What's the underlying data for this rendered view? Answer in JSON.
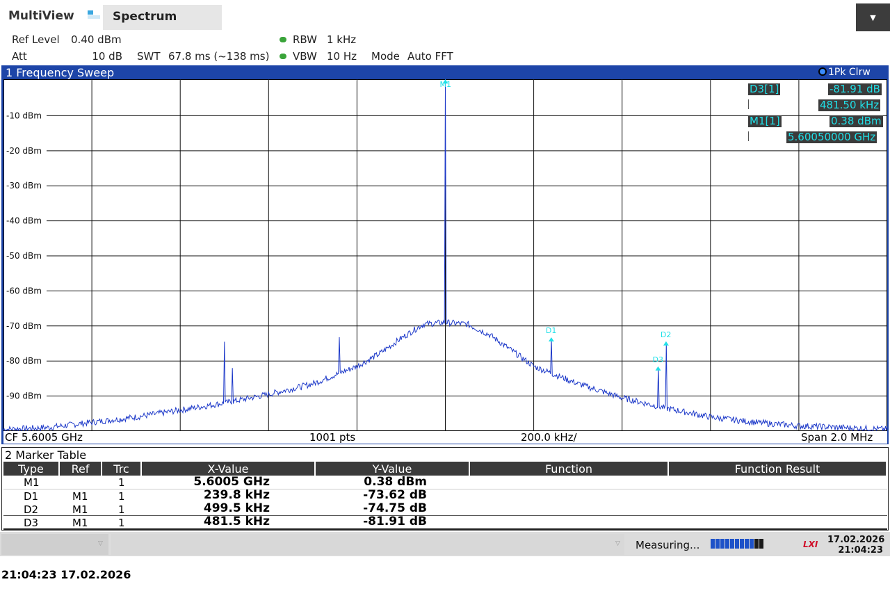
{
  "app": {
    "multiview_label": "MultiView",
    "tab_label": "Spectrum",
    "menu_glyph": "▼"
  },
  "settings": {
    "ref_level_label": "Ref Level",
    "ref_level_value": "0.40 dBm",
    "att_label": "Att",
    "att_value": "10 dB",
    "swt_label": "SWT",
    "swt_value": "67.8 ms (~138 ms)",
    "rbw_label": "RBW",
    "rbw_value": "1 kHz",
    "vbw_label": "VBW",
    "vbw_value": "10 Hz",
    "mode_label": "Mode",
    "mode_value": "Auto FFT"
  },
  "diagram1": {
    "title": "1 Frequency Sweep",
    "trace_label": "1Pk Clrw",
    "footer": {
      "cf": "CF 5.6005 GHz",
      "points": "1001 pts",
      "div": "200.0 kHz/",
      "span": "Span 2.0 MHz"
    }
  },
  "marker_info": {
    "d3_label": "D3[1]",
    "d3_value": "-81.91 dB",
    "d3_freq": "481.50 kHz",
    "m1_label": "M1[1]",
    "m1_value": "0.38 dBm",
    "m1_freq": "5.60050000 GHz"
  },
  "chart_data": {
    "type": "line",
    "xlabel": "",
    "ylabel": "",
    "center_freq_ghz": 5.6005,
    "span_mhz": 2.0,
    "ylim": [
      -100,
      0.4
    ],
    "y_ticks": [
      "-10 dBm",
      "-20 dBm",
      "-30 dBm",
      "-40 dBm",
      "-50 dBm",
      "-60 dBm",
      "-70 dBm",
      "-80 dBm",
      "-90 dBm"
    ],
    "y_tick_values": [
      -10,
      -20,
      -30,
      -40,
      -50,
      -60,
      -70,
      -80,
      -90
    ],
    "grid": true,
    "series": [
      {
        "color": "#1d39c9",
        "points_offset_khz_dbm": [
          [
            -1000,
            -99.5
          ],
          [
            -900,
            -99
          ],
          [
            -800,
            -97.5
          ],
          [
            -700,
            -96
          ],
          [
            -600,
            -94
          ],
          [
            -500,
            -92
          ],
          [
            -400,
            -89.5
          ],
          [
            -300,
            -86.5
          ],
          [
            -200,
            -81.5
          ],
          [
            -150,
            -78
          ],
          [
            -100,
            -73.5
          ],
          [
            -50,
            -69.5
          ],
          [
            0,
            -69
          ],
          [
            50,
            -69.5
          ],
          [
            100,
            -72.5
          ],
          [
            150,
            -77
          ],
          [
            200,
            -81.5
          ],
          [
            300,
            -86.5
          ],
          [
            400,
            -90.5
          ],
          [
            500,
            -93.5
          ],
          [
            600,
            -96
          ],
          [
            700,
            -97.5
          ],
          [
            800,
            -98.5
          ],
          [
            900,
            -99
          ],
          [
            1000,
            -99.5
          ]
        ],
        "spurs_offset_khz_dbm": [
          [
            -499.5,
            -74.5
          ],
          [
            -481.5,
            -82
          ],
          [
            -239.8,
            -73.2
          ],
          [
            0,
            0.38
          ],
          [
            239.8,
            -73.62
          ],
          [
            481.5,
            -81.91
          ],
          [
            499.5,
            -74.75
          ]
        ]
      }
    ],
    "markers": [
      {
        "label": "M1",
        "offset_khz": 0,
        "dbm": 0.38
      },
      {
        "label": "D1",
        "offset_khz": 239.8,
        "dbm": -73.24
      },
      {
        "label": "D2",
        "offset_khz": 499.5,
        "dbm": -74.37
      },
      {
        "label": "D3",
        "offset_khz": 481.5,
        "dbm": -81.53
      }
    ]
  },
  "diagram2": {
    "title": "2 Marker Table",
    "headers": [
      "Type",
      "Ref",
      "Trc",
      "X-Value",
      "Y-Value",
      "Function",
      "Function Result"
    ],
    "rows": [
      {
        "type": "M1",
        "ref": "",
        "trc": "1",
        "x": "5.6005 GHz",
        "y": "0.38 dBm"
      },
      {
        "type": "D1",
        "ref": "M1",
        "trc": "1",
        "x": "239.8 kHz",
        "y": "-73.62 dB"
      },
      {
        "type": "D2",
        "ref": "M1",
        "trc": "1",
        "x": "499.5 kHz",
        "y": "-74.75 dB"
      },
      {
        "type": "D3",
        "ref": "M1",
        "trc": "1",
        "x": "481.5 kHz",
        "y": "-81.91 dB"
      }
    ]
  },
  "status": {
    "measuring": "Measuring...",
    "lxi": "LXI",
    "date": "17.02.2026",
    "time": "21:04:23",
    "progress": 0.85
  },
  "footer_timestamp": "21:04:23  17.02.2026",
  "colors": {
    "accent_blue": "#1d45a8",
    "trace": "#1d39c9",
    "marker": "#20e0e8"
  }
}
